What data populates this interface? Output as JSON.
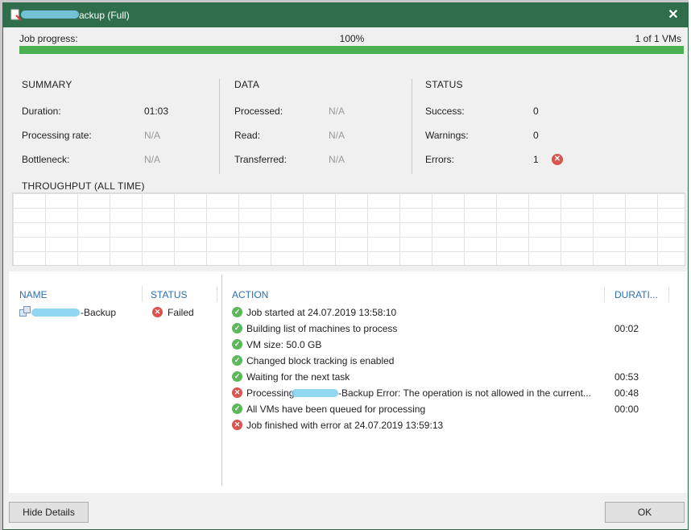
{
  "window": {
    "title": "ackup (Full)"
  },
  "progress": {
    "label": "Job progress:",
    "percent_text": "100%",
    "value": 1.0,
    "count_text": "1 of 1 VMs",
    "color": "#4caf50"
  },
  "summary": {
    "heading": "SUMMARY",
    "duration_label": "Duration:",
    "duration_value": "01:03",
    "rate_label": "Processing rate:",
    "rate_value": "N/A",
    "bottleneck_label": "Bottleneck:",
    "bottleneck_value": "N/A"
  },
  "data": {
    "heading": "DATA",
    "processed_label": "Processed:",
    "processed_value": "N/A",
    "read_label": "Read:",
    "read_value": "N/A",
    "transferred_label": "Transferred:",
    "transferred_value": "N/A"
  },
  "status": {
    "heading": "STATUS",
    "success_label": "Success:",
    "success_value": "0",
    "warnings_label": "Warnings:",
    "warnings_value": "0",
    "errors_label": "Errors:",
    "errors_value": "1"
  },
  "throughput": {
    "heading": "THROUGHPUT (ALL TIME)"
  },
  "vm_list": {
    "columns": {
      "name": "NAME",
      "status": "STATUS"
    },
    "rows": [
      {
        "name_suffix": "-Backup",
        "status": "Failed"
      }
    ]
  },
  "actions": {
    "columns": {
      "action": "ACTION",
      "duration": "DURATI..."
    },
    "rows": [
      {
        "state": "ok",
        "text": "Job started at 24.07.2019 13:58:10",
        "duration": ""
      },
      {
        "state": "ok",
        "text": "Building list of machines to process",
        "duration": "00:02"
      },
      {
        "state": "ok",
        "text": "VM size: 50.0 GB",
        "duration": ""
      },
      {
        "state": "ok",
        "text": "Changed block tracking is enabled",
        "duration": ""
      },
      {
        "state": "ok",
        "text": "Waiting for the next task",
        "duration": "00:53"
      },
      {
        "state": "error",
        "text_prefix": "Processing",
        "text": "-Backup Error: The operation is not allowed in the current...",
        "duration": "00:48"
      },
      {
        "state": "ok",
        "text": "All VMs have been queued for processing",
        "duration": "00:00"
      },
      {
        "state": "error",
        "text": "Job finished with error at 24.07.2019 13:59:13",
        "duration": ""
      }
    ]
  },
  "buttons": {
    "hide_details": "Hide Details",
    "ok": "OK"
  },
  "icons": {
    "title": "backup-job-icon",
    "close": "close-icon",
    "ok": "check-circle-icon",
    "error": "x-circle-icon",
    "vm": "vm-icon"
  },
  "colors": {
    "titlebar": "#2e6e4c",
    "header_text": "#2a6fb5",
    "success": "#5cb85c",
    "error": "#d9534f"
  }
}
